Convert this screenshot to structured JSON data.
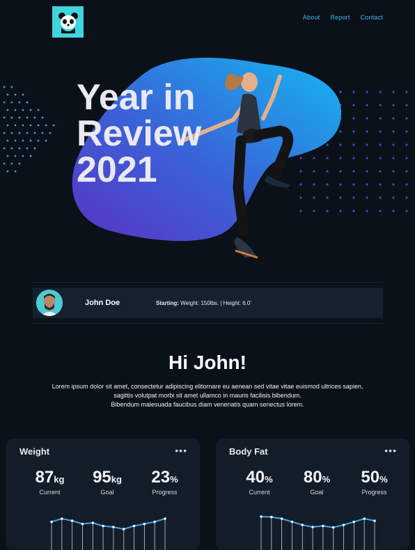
{
  "nav": {
    "links": [
      "About",
      "Report",
      "Contact"
    ]
  },
  "hero": {
    "title_lines": [
      "Year in",
      "Review",
      "2021"
    ]
  },
  "profile": {
    "name": "John Doe",
    "starting_label": "Starting:",
    "starting_details": " Weight: 150lbs.  |  Height: 6.0'"
  },
  "greeting": {
    "title": "Hi John!",
    "line1": "Lorem ipsum dolor sit amet, consectetur adipiscing elitornare eu aenean sed vitae vitae euismod ultrices sapien,",
    "line2": "sagittis volutpat morbi sit amet ullamco in mauris facilisis bibendum.",
    "line3": "Bibendum malesuada faucibus diam venenatis quam  senectus lorem."
  },
  "cards": [
    {
      "title": "Weight",
      "more": "•••",
      "metrics": [
        {
          "value": "87",
          "unit": "kg",
          "label": "Current"
        },
        {
          "value": "95",
          "unit": "kg",
          "label": "Goal"
        },
        {
          "value": "23",
          "unit": "%",
          "label": "Progress"
        }
      ],
      "trend": [
        0.55,
        0.7,
        0.6,
        0.45,
        0.5,
        0.35,
        0.3,
        0.2,
        0.35,
        0.45,
        0.55,
        0.7
      ]
    },
    {
      "title": "Body Fat",
      "more": "•••",
      "metrics": [
        {
          "value": "40",
          "unit": "%",
          "label": "Current"
        },
        {
          "value": "80",
          "unit": "%",
          "label": "Goal"
        },
        {
          "value": "50",
          "unit": "%",
          "label": "Progress"
        }
      ],
      "trend": [
        0.8,
        0.78,
        0.7,
        0.55,
        0.4,
        0.3,
        0.35,
        0.28,
        0.4,
        0.55,
        0.7,
        0.6
      ]
    }
  ],
  "colors": {
    "accent": "#3fb6e6",
    "logo_bg": "#3fd6df",
    "blob_start": "#1aa8f0",
    "blob_end": "#5b36c8"
  }
}
